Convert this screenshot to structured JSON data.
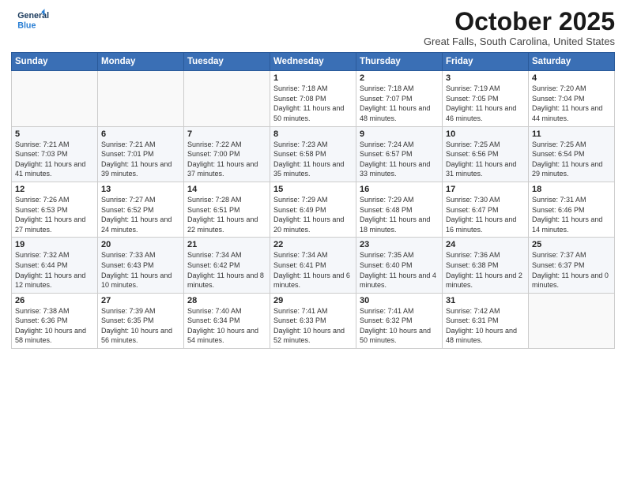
{
  "logo": {
    "line1": "General",
    "line2": "Blue"
  },
  "header": {
    "month": "October 2025",
    "location": "Great Falls, South Carolina, United States"
  },
  "weekdays": [
    "Sunday",
    "Monday",
    "Tuesday",
    "Wednesday",
    "Thursday",
    "Friday",
    "Saturday"
  ],
  "weeks": [
    [
      {
        "day": "",
        "sunrise": "",
        "sunset": "",
        "daylight": ""
      },
      {
        "day": "",
        "sunrise": "",
        "sunset": "",
        "daylight": ""
      },
      {
        "day": "",
        "sunrise": "",
        "sunset": "",
        "daylight": ""
      },
      {
        "day": "1",
        "sunrise": "Sunrise: 7:18 AM",
        "sunset": "Sunset: 7:08 PM",
        "daylight": "Daylight: 11 hours and 50 minutes."
      },
      {
        "day": "2",
        "sunrise": "Sunrise: 7:18 AM",
        "sunset": "Sunset: 7:07 PM",
        "daylight": "Daylight: 11 hours and 48 minutes."
      },
      {
        "day": "3",
        "sunrise": "Sunrise: 7:19 AM",
        "sunset": "Sunset: 7:05 PM",
        "daylight": "Daylight: 11 hours and 46 minutes."
      },
      {
        "day": "4",
        "sunrise": "Sunrise: 7:20 AM",
        "sunset": "Sunset: 7:04 PM",
        "daylight": "Daylight: 11 hours and 44 minutes."
      }
    ],
    [
      {
        "day": "5",
        "sunrise": "Sunrise: 7:21 AM",
        "sunset": "Sunset: 7:03 PM",
        "daylight": "Daylight: 11 hours and 41 minutes."
      },
      {
        "day": "6",
        "sunrise": "Sunrise: 7:21 AM",
        "sunset": "Sunset: 7:01 PM",
        "daylight": "Daylight: 11 hours and 39 minutes."
      },
      {
        "day": "7",
        "sunrise": "Sunrise: 7:22 AM",
        "sunset": "Sunset: 7:00 PM",
        "daylight": "Daylight: 11 hours and 37 minutes."
      },
      {
        "day": "8",
        "sunrise": "Sunrise: 7:23 AM",
        "sunset": "Sunset: 6:58 PM",
        "daylight": "Daylight: 11 hours and 35 minutes."
      },
      {
        "day": "9",
        "sunrise": "Sunrise: 7:24 AM",
        "sunset": "Sunset: 6:57 PM",
        "daylight": "Daylight: 11 hours and 33 minutes."
      },
      {
        "day": "10",
        "sunrise": "Sunrise: 7:25 AM",
        "sunset": "Sunset: 6:56 PM",
        "daylight": "Daylight: 11 hours and 31 minutes."
      },
      {
        "day": "11",
        "sunrise": "Sunrise: 7:25 AM",
        "sunset": "Sunset: 6:54 PM",
        "daylight": "Daylight: 11 hours and 29 minutes."
      }
    ],
    [
      {
        "day": "12",
        "sunrise": "Sunrise: 7:26 AM",
        "sunset": "Sunset: 6:53 PM",
        "daylight": "Daylight: 11 hours and 27 minutes."
      },
      {
        "day": "13",
        "sunrise": "Sunrise: 7:27 AM",
        "sunset": "Sunset: 6:52 PM",
        "daylight": "Daylight: 11 hours and 24 minutes."
      },
      {
        "day": "14",
        "sunrise": "Sunrise: 7:28 AM",
        "sunset": "Sunset: 6:51 PM",
        "daylight": "Daylight: 11 hours and 22 minutes."
      },
      {
        "day": "15",
        "sunrise": "Sunrise: 7:29 AM",
        "sunset": "Sunset: 6:49 PM",
        "daylight": "Daylight: 11 hours and 20 minutes."
      },
      {
        "day": "16",
        "sunrise": "Sunrise: 7:29 AM",
        "sunset": "Sunset: 6:48 PM",
        "daylight": "Daylight: 11 hours and 18 minutes."
      },
      {
        "day": "17",
        "sunrise": "Sunrise: 7:30 AM",
        "sunset": "Sunset: 6:47 PM",
        "daylight": "Daylight: 11 hours and 16 minutes."
      },
      {
        "day": "18",
        "sunrise": "Sunrise: 7:31 AM",
        "sunset": "Sunset: 6:46 PM",
        "daylight": "Daylight: 11 hours and 14 minutes."
      }
    ],
    [
      {
        "day": "19",
        "sunrise": "Sunrise: 7:32 AM",
        "sunset": "Sunset: 6:44 PM",
        "daylight": "Daylight: 11 hours and 12 minutes."
      },
      {
        "day": "20",
        "sunrise": "Sunrise: 7:33 AM",
        "sunset": "Sunset: 6:43 PM",
        "daylight": "Daylight: 11 hours and 10 minutes."
      },
      {
        "day": "21",
        "sunrise": "Sunrise: 7:34 AM",
        "sunset": "Sunset: 6:42 PM",
        "daylight": "Daylight: 11 hours and 8 minutes."
      },
      {
        "day": "22",
        "sunrise": "Sunrise: 7:34 AM",
        "sunset": "Sunset: 6:41 PM",
        "daylight": "Daylight: 11 hours and 6 minutes."
      },
      {
        "day": "23",
        "sunrise": "Sunrise: 7:35 AM",
        "sunset": "Sunset: 6:40 PM",
        "daylight": "Daylight: 11 hours and 4 minutes."
      },
      {
        "day": "24",
        "sunrise": "Sunrise: 7:36 AM",
        "sunset": "Sunset: 6:38 PM",
        "daylight": "Daylight: 11 hours and 2 minutes."
      },
      {
        "day": "25",
        "sunrise": "Sunrise: 7:37 AM",
        "sunset": "Sunset: 6:37 PM",
        "daylight": "Daylight: 11 hours and 0 minutes."
      }
    ],
    [
      {
        "day": "26",
        "sunrise": "Sunrise: 7:38 AM",
        "sunset": "Sunset: 6:36 PM",
        "daylight": "Daylight: 10 hours and 58 minutes."
      },
      {
        "day": "27",
        "sunrise": "Sunrise: 7:39 AM",
        "sunset": "Sunset: 6:35 PM",
        "daylight": "Daylight: 10 hours and 56 minutes."
      },
      {
        "day": "28",
        "sunrise": "Sunrise: 7:40 AM",
        "sunset": "Sunset: 6:34 PM",
        "daylight": "Daylight: 10 hours and 54 minutes."
      },
      {
        "day": "29",
        "sunrise": "Sunrise: 7:41 AM",
        "sunset": "Sunset: 6:33 PM",
        "daylight": "Daylight: 10 hours and 52 minutes."
      },
      {
        "day": "30",
        "sunrise": "Sunrise: 7:41 AM",
        "sunset": "Sunset: 6:32 PM",
        "daylight": "Daylight: 10 hours and 50 minutes."
      },
      {
        "day": "31",
        "sunrise": "Sunrise: 7:42 AM",
        "sunset": "Sunset: 6:31 PM",
        "daylight": "Daylight: 10 hours and 48 minutes."
      },
      {
        "day": "",
        "sunrise": "",
        "sunset": "",
        "daylight": ""
      }
    ]
  ]
}
